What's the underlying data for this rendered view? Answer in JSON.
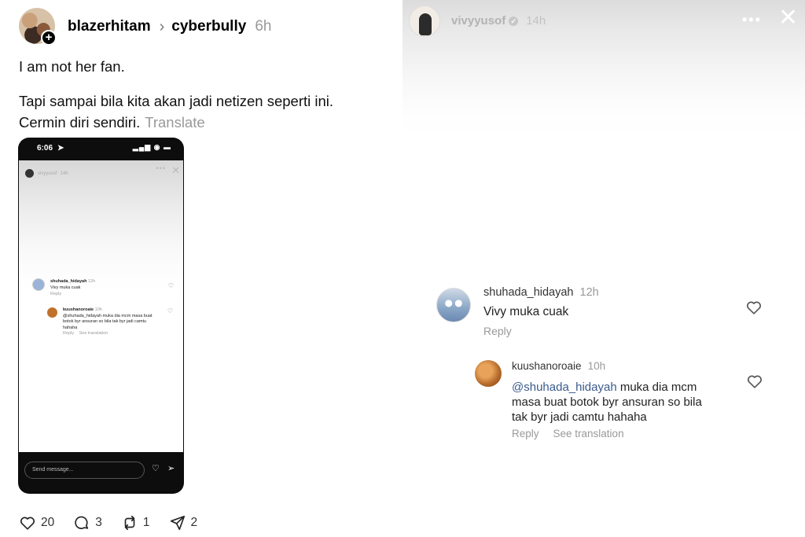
{
  "post": {
    "author": "blazerhitam",
    "separator": ">",
    "topic": "cyberbully",
    "time": "6h",
    "paragraph1": "I am not her fan.",
    "paragraph2_line1": "Tapi sampai bila kita akan jadi netizen seperti ini.",
    "paragraph2_line2": "Cermin diri sendiri.",
    "translate": "Translate",
    "actions": {
      "likes": "20",
      "replies": "3",
      "reposts": "1",
      "shares": "2"
    }
  },
  "embedded_screenshot": {
    "status_time": "6:06",
    "story_user": "vivyyusof",
    "story_time": "14h",
    "comment1": {
      "user": "shuhada_hidayah",
      "time": "12h",
      "text": "Vivy muka cuak",
      "reply": "Reply"
    },
    "comment2": {
      "user": "kuushanoroaie",
      "time": "10h",
      "text": "@shuhada_hidayah muka dia mcm masa buat botok byr ansuran so bila tak byr jadi camtu hahaha",
      "reply": "Reply",
      "see_translation": "See translation"
    },
    "send_placeholder": "Send message..."
  },
  "story": {
    "user": "vivyyusof",
    "time": "14h",
    "comment1": {
      "user": "shuhada_hidayah",
      "time": "12h",
      "text": "Vivy muka cuak",
      "reply": "Reply"
    },
    "comment2": {
      "user": "kuushanoroaie",
      "time": "10h",
      "mention": "@shuhada_hidayah",
      "text_line1": " muka dia mcm",
      "text_line2": "masa buat botok byr ansuran so bila",
      "text_line3": "tak byr jadi camtu hahaha",
      "reply": "Reply",
      "see_translation": "See translation"
    }
  },
  "icons": [
    "plus-icon",
    "chevron-right-icon",
    "heart-icon",
    "comment-icon",
    "repost-icon",
    "share-icon",
    "verified-icon",
    "more-icon",
    "close-icon",
    "send-icon"
  ]
}
